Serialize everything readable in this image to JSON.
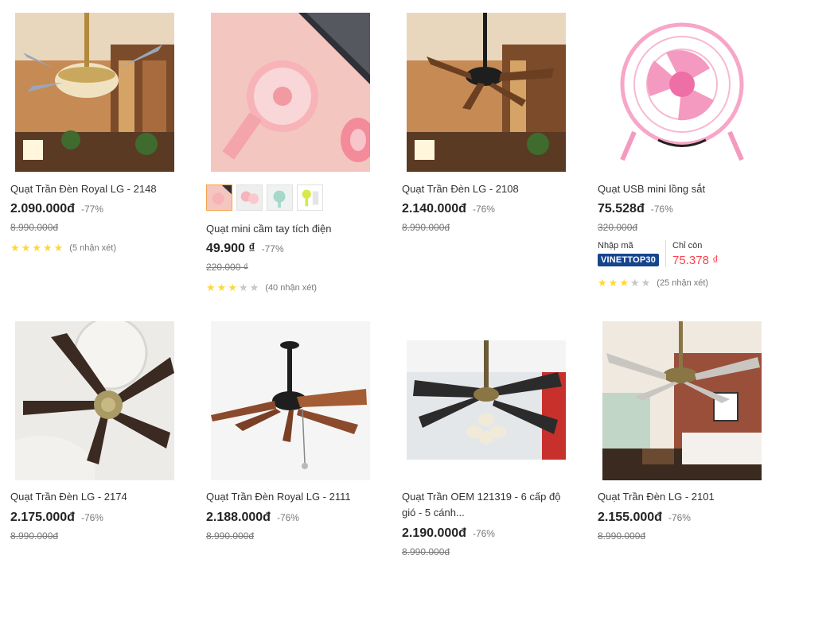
{
  "colors": {
    "price": "#242424",
    "star": "#fdd836",
    "star_off": "#c7c7c7",
    "coupon_bg": "#16458d",
    "coupon_price": "#ff424e"
  },
  "products": [
    {
      "name": "Quạt Trần Đèn Royal LG - 2148",
      "price": "2.090.000đ",
      "discount": "-77%",
      "old_price": "8.990.000đ",
      "rating": 5,
      "reviews": "(5 nhận xét)"
    },
    {
      "name": "Quạt mini cầm tay tích điện",
      "price": "49.900 ₫",
      "discount": "-77%",
      "old_price": "220.000 ₫",
      "rating": 3,
      "reviews": "(40 nhận xét)"
    },
    {
      "name": "Quạt Trần Đèn LG - 2108",
      "price": "2.140.000đ",
      "discount": "-76%",
      "old_price": "8.990.000đ"
    },
    {
      "name": "Quạt USB mini lồng sắt",
      "price": "75.528đ",
      "discount": "-76%",
      "old_price": "320.000đ",
      "coupon": {
        "label": "Nhập mã",
        "code": "VINETTOP30",
        "only_label": "Chỉ còn",
        "final_price": "75.378 ₫"
      },
      "rating": 3,
      "reviews": "(25 nhận xét)"
    },
    {
      "name": "Quạt Trần Đèn LG - 2174",
      "price": "2.175.000đ",
      "discount": "-76%",
      "old_price": "8.990.000đ"
    },
    {
      "name": "Quạt Trần Đèn Royal LG - 2111",
      "price": "2.188.000đ",
      "discount": "-76%",
      "old_price": "8.990.000đ"
    },
    {
      "name": "Quạt Trần OEM 121319 - 6 cấp độ gió - 5 cánh...",
      "price": "2.190.000đ",
      "discount": "-76%",
      "old_price": "8.990.000đ"
    },
    {
      "name": "Quạt Trần Đèn LG - 2101",
      "price": "2.155.000đ",
      "discount": "-76%",
      "old_price": "8.990.000đ"
    }
  ]
}
